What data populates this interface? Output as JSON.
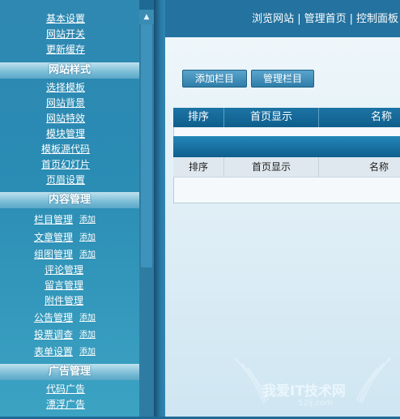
{
  "sidebar": {
    "top_links": [
      "基本设置",
      "网站开关",
      "更新缓存"
    ],
    "sections": [
      {
        "title": "网站样式",
        "items": [
          "选择模板",
          "网站背景",
          "网站特效",
          "模块管理",
          "模板源代码",
          "首页幻灯片",
          "页眉设置"
        ]
      },
      {
        "title": "内容管理",
        "items": [
          {
            "label": "栏目管理",
            "add": "添加"
          },
          {
            "label": "文章管理",
            "add": "添加"
          },
          {
            "label": "组图管理",
            "add": "添加"
          },
          {
            "label": "评论管理",
            "add": ""
          },
          {
            "label": "留言管理",
            "add": ""
          },
          {
            "label": "附件管理",
            "add": ""
          },
          {
            "label": "公告管理",
            "add": "添加"
          },
          {
            "label": "投票调查",
            "add": "添加"
          },
          {
            "label": "表单设置",
            "add": "添加"
          }
        ]
      },
      {
        "title": "广告管理",
        "items": [
          "代码广告",
          "漂浮广告"
        ]
      }
    ]
  },
  "header": {
    "links": [
      "浏览网站",
      "管理首页",
      "控制面板"
    ],
    "separator": "|"
  },
  "toolbar": {
    "add_column": "添加栏目",
    "manage_column": "管理栏目"
  },
  "table": {
    "headers": [
      "排序",
      "首页显示",
      "名称"
    ],
    "subheaders": [
      "排序",
      "首页显示",
      "名称"
    ]
  },
  "watermark": {
    "text": "我爱IT技术网",
    "subtext": "52ij.com"
  },
  "colors": {
    "sidebar_bg": "#2e88b2",
    "section_header": "#79bcd6",
    "table_header": "#1c74a5",
    "main_bg": "#e2f0f7"
  }
}
